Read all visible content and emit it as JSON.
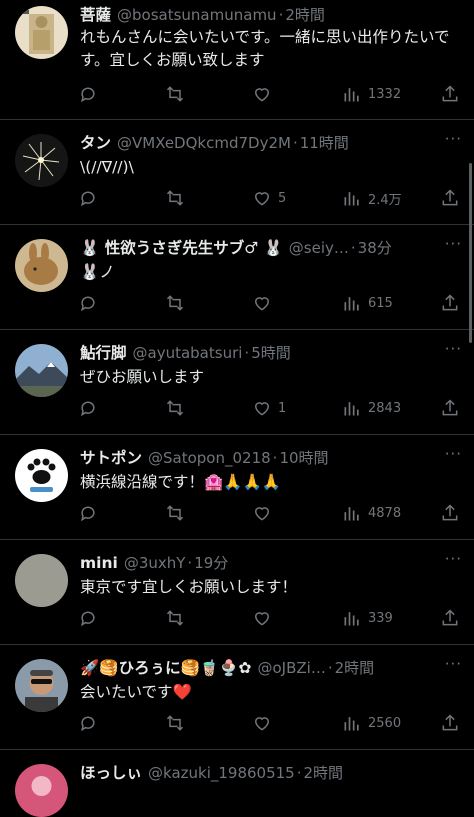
{
  "tweets": [
    {
      "name": "菩薩",
      "handle": "@bosatsunamunamu",
      "time": "2時間",
      "text": "れもんさんに会いたいです。一緒に思い出作りたいです。宜しくお願い致します",
      "replies": "",
      "retweets": "",
      "likes": "",
      "views": "1332",
      "avatar_icon": "buddha-statue-avatar",
      "avatar_color": "#c9b48a"
    },
    {
      "name": "タン",
      "handle": "@VMXeDQkcmd7Dy2M",
      "time": "11時間",
      "text": "\\(//∇//)\\",
      "replies": "",
      "retweets": "",
      "likes": "5",
      "views": "2.4万",
      "avatar_icon": "fireworks-avatar",
      "avatar_color": "#1b1b1b"
    },
    {
      "name": "🐰 性欲うさぎ先生サブ♂ 🐰",
      "handle": "@seiy…",
      "time": "38分",
      "text": "🐰ノ",
      "replies": "",
      "retweets": "",
      "likes": "",
      "views": "615",
      "avatar_icon": "rabbit-avatar",
      "avatar_color": "#b08a55"
    },
    {
      "name": "鮎行脚",
      "handle": "@ayutabatsuri",
      "time": "5時間",
      "text": "ぜひお願いします",
      "replies": "",
      "retweets": "",
      "likes": "1",
      "views": "2843",
      "avatar_icon": "mountain-avatar",
      "avatar_color": "#6b88a8"
    },
    {
      "name": "サトポン",
      "handle": "@Satopon_0218",
      "time": "10時間",
      "text": "横浜線沿線です！🏩🙏🙏🙏",
      "replies": "",
      "retweets": "",
      "likes": "",
      "views": "4878",
      "avatar_icon": "paw-avatar",
      "avatar_color": "#ffffff"
    },
    {
      "name": "mini",
      "handle": "@3uxhY",
      "time": "19分",
      "text": "東京です宜しくお願いします！",
      "replies": "",
      "retweets": "",
      "likes": "",
      "views": "339",
      "avatar_icon": "gray-default-avatar",
      "avatar_color": "#9a9a8f"
    },
    {
      "name": "🚀🥞ひろぅに🥞🧋🍨✿",
      "handle": "@oJBZi…",
      "time": "2時間",
      "text": "会いたいです❤️",
      "replies": "",
      "retweets": "",
      "likes": "",
      "views": "2560",
      "avatar_icon": "sunglasses-person-avatar",
      "avatar_color": "#7a8a9a"
    },
    {
      "name": "ほっしぃ",
      "handle": "@kazuki_19860515",
      "time": "2時間",
      "text": "",
      "replies": "",
      "retweets": "",
      "likes": "",
      "views": "",
      "avatar_icon": "pink-avatar",
      "avatar_color": "#d6567a"
    }
  ],
  "icons": {
    "reply": "reply-icon",
    "retweet": "retweet-icon",
    "like": "heart-icon",
    "views": "views-bar-chart-icon",
    "share": "share-icon",
    "more": "more-options-icon"
  },
  "more_label": "···",
  "dot_separator": "·"
}
